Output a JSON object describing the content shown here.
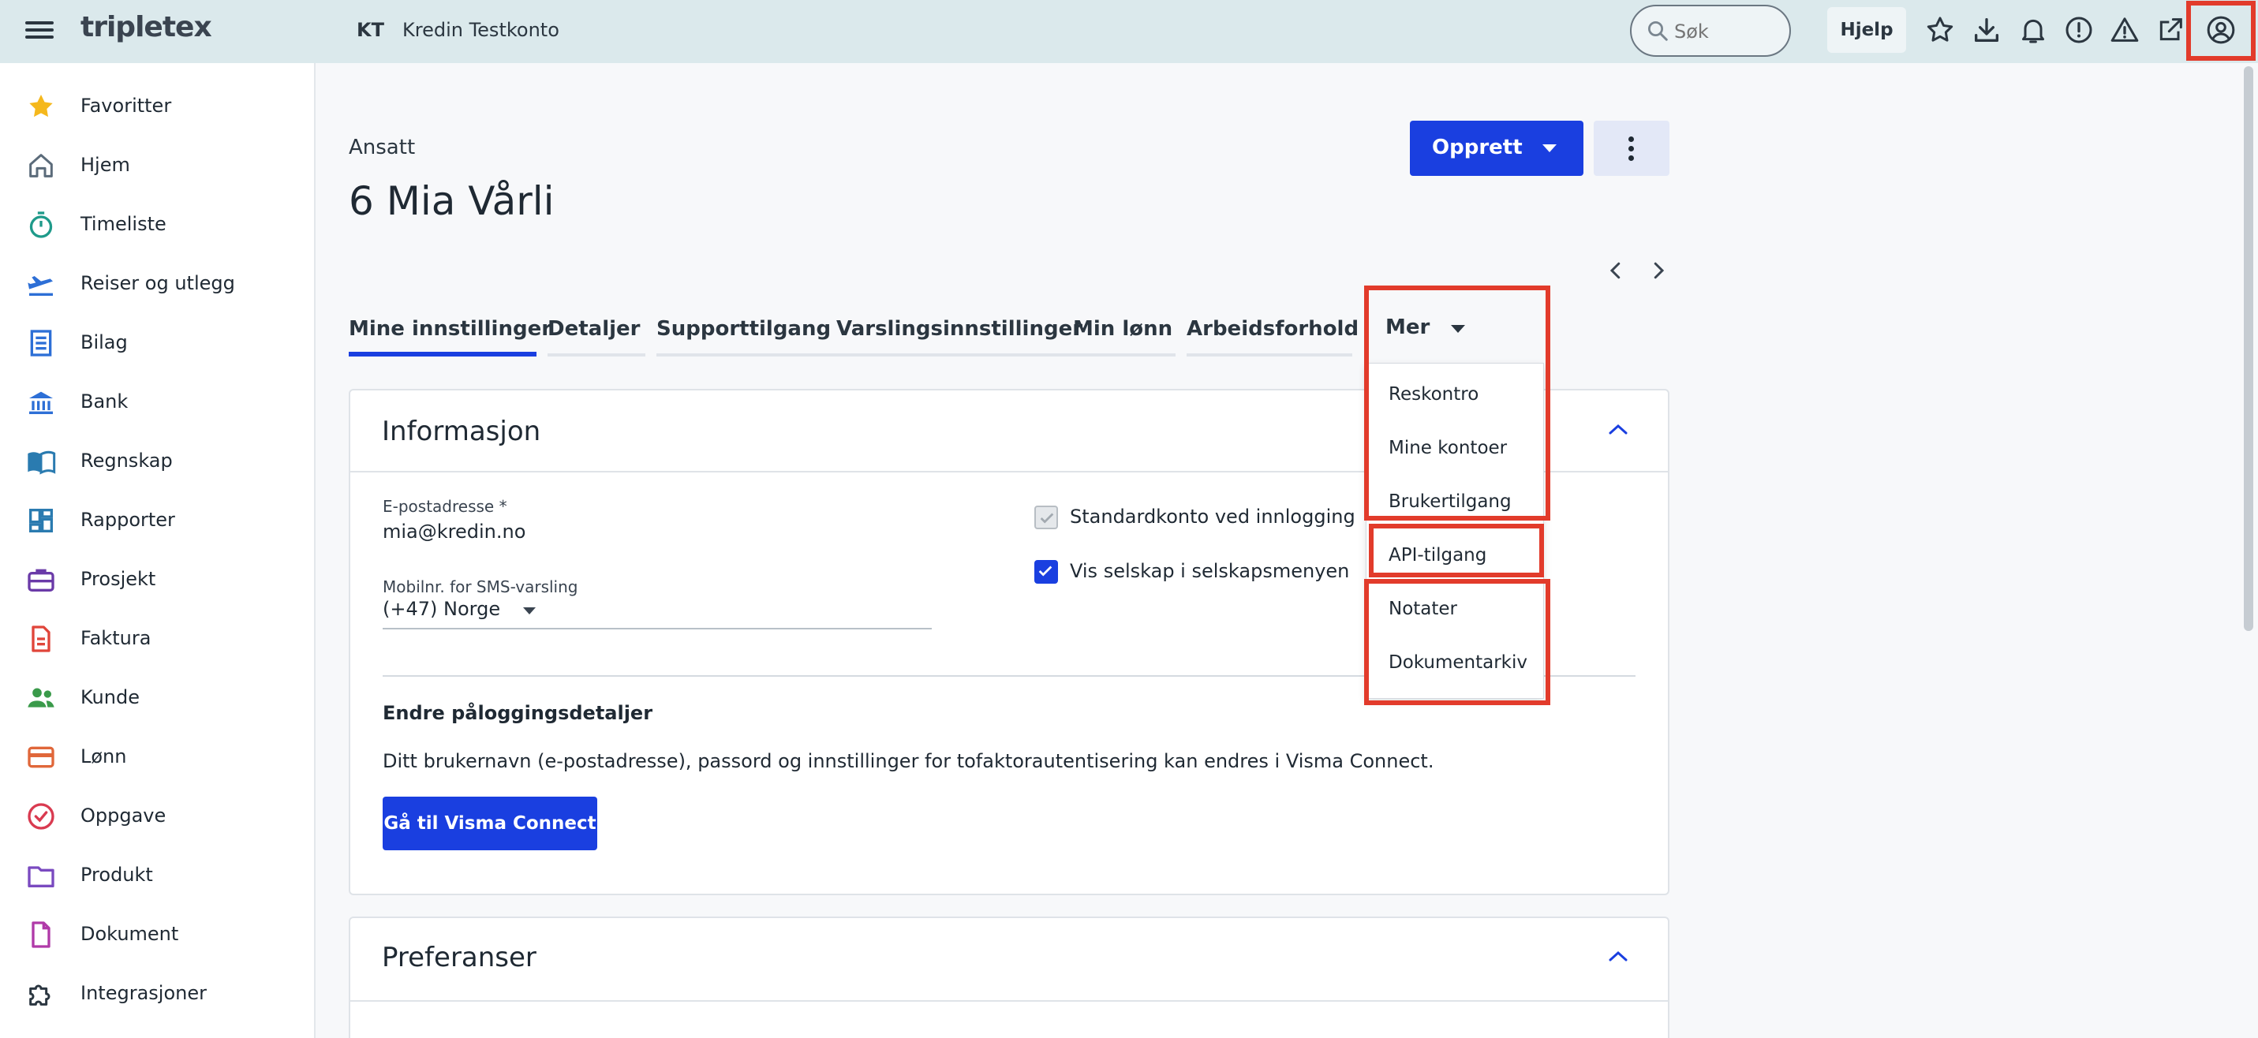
{
  "topbar": {
    "logo": "tripletex",
    "account_abbr": "KT",
    "account_name": "Kredin Testkonto",
    "search_placeholder": "Søk",
    "help_label": "Hjelp",
    "icons": [
      "star-icon",
      "download-icon",
      "bell-icon",
      "info-alert-icon",
      "warning-icon",
      "external-link-icon",
      "profile-icon"
    ]
  },
  "sidebar": {
    "items": [
      {
        "label": "Favoritter",
        "icon": "star-icon"
      },
      {
        "label": "Hjem",
        "icon": "home-icon"
      },
      {
        "label": "Timeliste",
        "icon": "stopwatch-icon"
      },
      {
        "label": "Reiser og utlegg",
        "icon": "plane-icon"
      },
      {
        "label": "Bilag",
        "icon": "receipt-icon"
      },
      {
        "label": "Bank",
        "icon": "bank-icon"
      },
      {
        "label": "Regnskap",
        "icon": "book-icon"
      },
      {
        "label": "Rapporter",
        "icon": "dashboard-icon"
      },
      {
        "label": "Prosjekt",
        "icon": "briefcase-icon"
      },
      {
        "label": "Faktura",
        "icon": "invoice-icon"
      },
      {
        "label": "Kunde",
        "icon": "people-icon"
      },
      {
        "label": "Lønn",
        "icon": "card-icon"
      },
      {
        "label": "Oppgave",
        "icon": "check-circle-icon"
      },
      {
        "label": "Produkt",
        "icon": "folder-icon"
      },
      {
        "label": "Dokument",
        "icon": "document-icon"
      },
      {
        "label": "Integrasjoner",
        "icon": "puzzle-icon"
      }
    ]
  },
  "page": {
    "subtitle": "Ansatt",
    "title": "6 Mia Vårli",
    "create_label": "Opprett"
  },
  "tabs": [
    {
      "label": "Mine innstillinger",
      "active": true
    },
    {
      "label": "Detaljer"
    },
    {
      "label": "Supporttilgang"
    },
    {
      "label": "Varslingsinnstillinger"
    },
    {
      "label": "Min lønn"
    },
    {
      "label": "Arbeidsforhold"
    }
  ],
  "more_tab": {
    "label": "Mer",
    "items": [
      "Reskontro",
      "Mine kontoer",
      "Brukertilgang",
      "API-tilgang",
      "Notater",
      "Dokumentarkiv"
    ]
  },
  "info_card": {
    "title": "Informasjon",
    "email_label": "E-postadresse *",
    "email_value": "mia@kredin.no",
    "mobile_label": "Mobilnr. for SMS-varsling",
    "mobile_value": "(+47) Norge",
    "checkbox_default": "Standardkonto ved innlogging",
    "checkbox_show_company": "Vis selskap i selskapsmenyen",
    "login_section_title": "Endre påloggingsdetaljer",
    "login_section_text": "Ditt brukernavn (e-postadresse), passord og innstillinger for tofaktorautentisering kan endres i Visma Connect.",
    "visma_button": "Gå til Visma Connect"
  },
  "pref_card": {
    "title": "Preferanser"
  },
  "colors": {
    "accent": "#1a3fe0",
    "highlight": "#e23b2b",
    "topbar": "#dbe9ec"
  }
}
